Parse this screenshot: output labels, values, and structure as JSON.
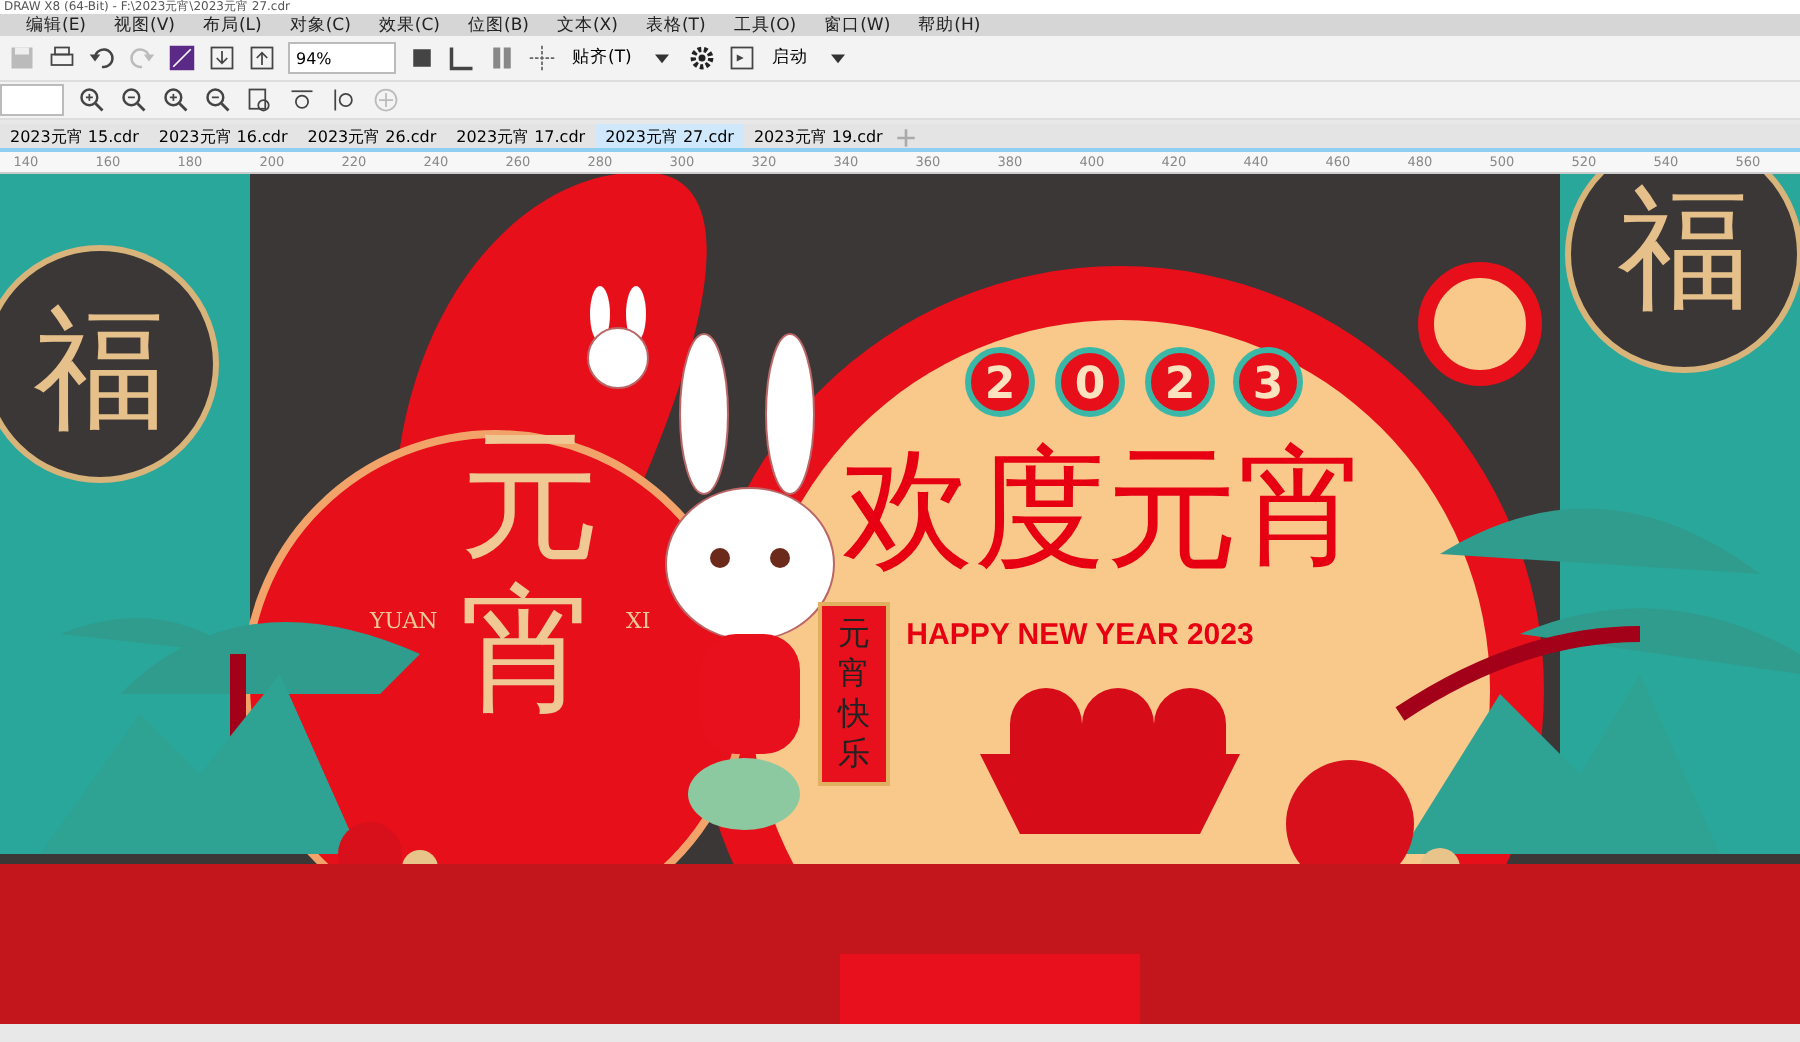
{
  "window": {
    "title": "DRAW X8 (64-Bit) - F:\\2023元宵\\2023元宵 27.cdr"
  },
  "menu": [
    "编辑(E)",
    "视图(V)",
    "布局(L)",
    "对象(C)",
    "效果(C)",
    "位图(B)",
    "文本(X)",
    "表格(T)",
    "工具(O)",
    "窗口(W)",
    "帮助(H)"
  ],
  "toolbar": {
    "zoom": "94%",
    "snap": "贴齐(T)",
    "launch": "启动"
  },
  "tabs": [
    {
      "label": "2023元宵 15.cdr",
      "selected": false
    },
    {
      "label": "2023元宵 16.cdr",
      "selected": false
    },
    {
      "label": "2023元宵 26.cdr",
      "selected": false
    },
    {
      "label": "2023元宵 17.cdr",
      "selected": false
    },
    {
      "label": "2023元宵 27.cdr",
      "selected": true
    },
    {
      "label": "2023元宵 19.cdr",
      "selected": false
    }
  ],
  "ruler": {
    "ticks": [
      "140",
      "160",
      "180",
      "200",
      "220",
      "240",
      "260",
      "280",
      "300",
      "320",
      "340",
      "360",
      "380",
      "400",
      "420",
      "440",
      "460",
      "480",
      "500",
      "520",
      "540",
      "560"
    ]
  },
  "artwork": {
    "year_digits": [
      "2",
      "0",
      "2",
      "3"
    ],
    "headline": "欢度元宵",
    "subtitle": "HAPPY NEW YEAR 2023",
    "side_title": "元宵",
    "pinyin_left": "YUAN",
    "pinyin_right": "XI",
    "fu_left": "福",
    "fu_right": "福",
    "scroll_text": "元宵快乐"
  }
}
